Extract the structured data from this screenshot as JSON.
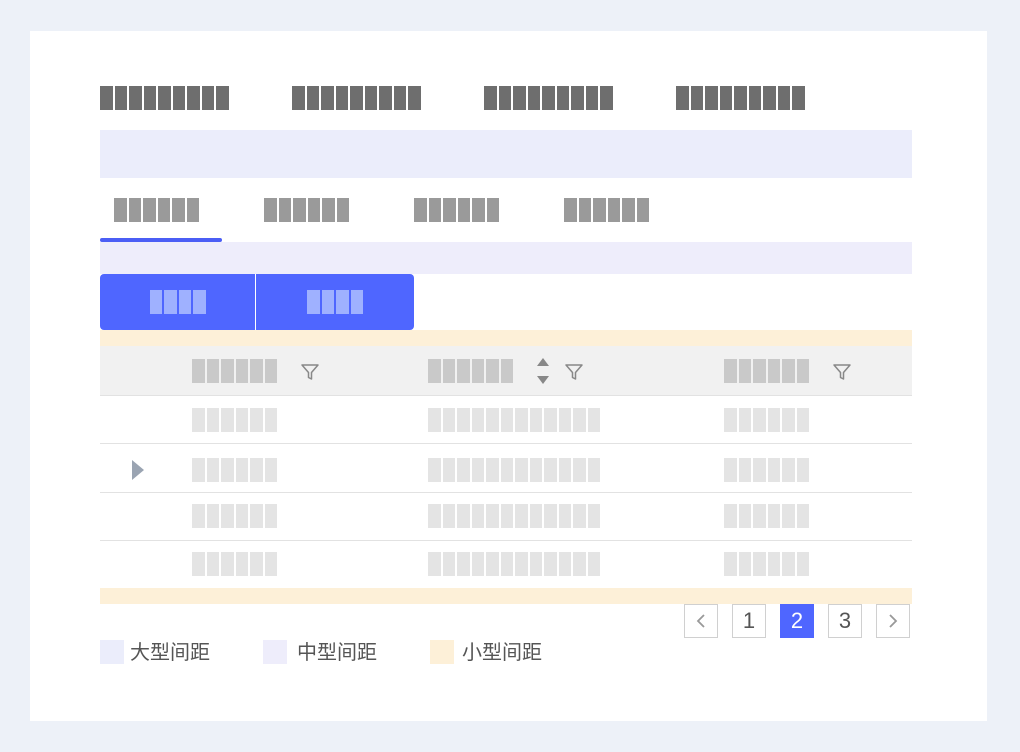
{
  "colors": {
    "page_bg": "#edf1f8",
    "card_bg": "#ffffff",
    "large_spacing": "#ebedfb",
    "medium_spacing": "#eeedfb",
    "small_spacing": "#fdf0d8",
    "accent": "#4f66ff",
    "tab_indicator": "#4b5ef5"
  },
  "pagination": {
    "prev_icon": "chevron-left-icon",
    "pages": [
      "1",
      "2",
      "3"
    ],
    "current_page": "2",
    "next_icon": "chevron-right-icon"
  },
  "legend": {
    "large": "大型间距",
    "medium": "中型间距",
    "small": "小型间距"
  },
  "table": {
    "active_tab_index": 0,
    "expandable_row_index": 1,
    "filter_icon": "filter-icon",
    "sort_icon": "sort-icon",
    "expand_icon": "caret-right-icon"
  }
}
